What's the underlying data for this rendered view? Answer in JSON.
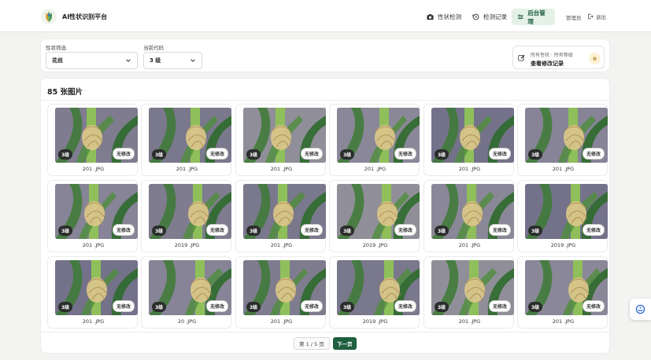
{
  "header": {
    "brand": "AI性状识别平台",
    "nav": [
      {
        "label": "性状检测",
        "icon": "camera-icon",
        "active": false
      },
      {
        "label": "检测记录",
        "icon": "history-icon",
        "active": false
      },
      {
        "label": "后台管理",
        "icon": "sliders-icon",
        "active": true
      }
    ],
    "user": "管理员",
    "logout": "退出"
  },
  "filters": {
    "trait_label": "性状筛选",
    "trait_value": "花丝",
    "code_label": "当前代码",
    "code_value": "3 级",
    "record_subtitle": "所有性状 · 所有等级",
    "record_title": "查看修改记录",
    "record_count": "0"
  },
  "gallery": {
    "title": "85 张图片",
    "cards": [
      {
        "level": "3级",
        "status": "无修改",
        "filename": "201          .JPG"
      },
      {
        "level": "3级",
        "status": "无修改",
        "filename": "201          .JPG"
      },
      {
        "level": "3级",
        "status": "无修改",
        "filename": "201          .JPG"
      },
      {
        "level": "3级",
        "status": "无修改",
        "filename": "201          .JPG"
      },
      {
        "level": "3级",
        "status": "无修改",
        "filename": "201          .JPG"
      },
      {
        "level": "3级",
        "status": "无修改",
        "filename": "201          .JPG"
      },
      {
        "level": "3级",
        "status": "无修改",
        "filename": "201          .JPG"
      },
      {
        "level": "3级",
        "status": "无修改",
        "filename": "2019          .JPG"
      },
      {
        "level": "3级",
        "status": "无修改",
        "filename": "201          .JPG"
      },
      {
        "level": "3级",
        "status": "无修改",
        "filename": "2019          .JPG"
      },
      {
        "level": "3级",
        "status": "无修改",
        "filename": "201          .JPG"
      },
      {
        "level": "3级",
        "status": "无修改",
        "filename": "2019          .JPG"
      },
      {
        "level": "3级",
        "status": "无修改",
        "filename": "201          .JPG"
      },
      {
        "level": "3级",
        "status": "无修改",
        "filename": "20          .JPG"
      },
      {
        "level": "3级",
        "status": "无修改",
        "filename": "201          .JPG"
      },
      {
        "level": "3级",
        "status": "无修改",
        "filename": "2019          .JPG"
      },
      {
        "level": "3级",
        "status": "无修改",
        "filename": "201          .JPG"
      },
      {
        "level": "3级",
        "status": "无修改",
        "filename": "201          .JPG"
      }
    ]
  },
  "pagination": {
    "info": "第 1 / 5 页",
    "next": "下一页"
  },
  "colors": {
    "accent": "#1e5f3e",
    "nav_active_bg": "#e4f1e7",
    "badge_dark": "#2a2d2b",
    "count_badge": "#fdf1d6"
  }
}
